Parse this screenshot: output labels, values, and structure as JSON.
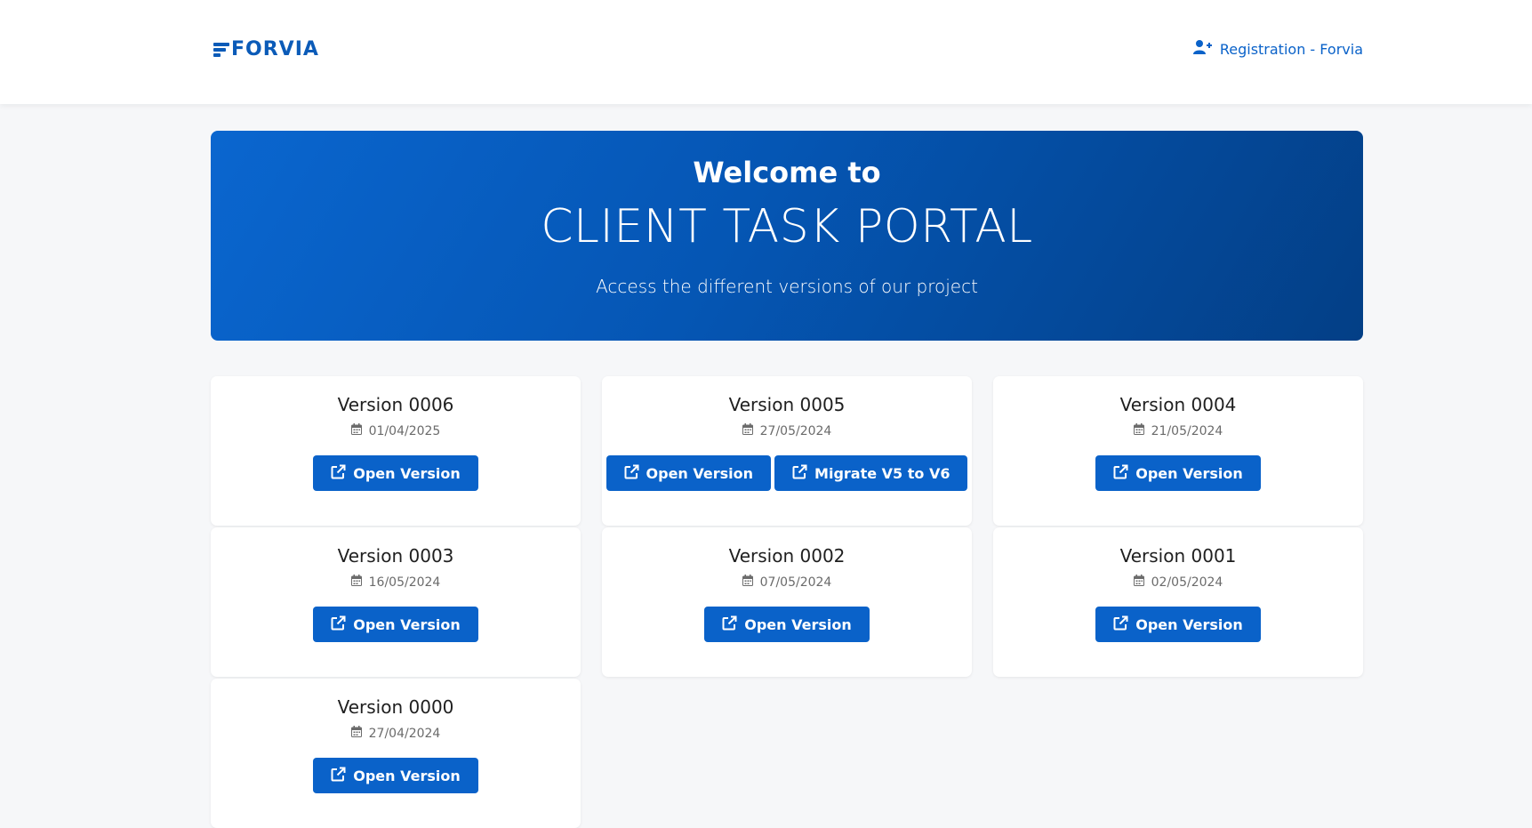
{
  "header": {
    "logo_text": "FORVIA",
    "registration_label": "Registration - Forvia"
  },
  "hero": {
    "welcome": "Welcome to",
    "title": "CLIENT TASK PORTAL",
    "subtitle": "Access the different versions of our project"
  },
  "versions": [
    {
      "name": "Version 0006",
      "date": "01/04/2025",
      "buttons": [
        "Open Version"
      ]
    },
    {
      "name": "Version 0005",
      "date": "27/05/2024",
      "buttons": [
        "Open Version",
        "Migrate V5 to V6"
      ]
    },
    {
      "name": "Version 0004",
      "date": "21/05/2024",
      "buttons": [
        "Open Version"
      ]
    },
    {
      "name": "Version 0003",
      "date": "16/05/2024",
      "buttons": [
        "Open Version"
      ]
    },
    {
      "name": "Version 0002",
      "date": "07/05/2024",
      "buttons": [
        "Open Version"
      ]
    },
    {
      "name": "Version 0001",
      "date": "02/05/2024",
      "buttons": [
        "Open Version"
      ]
    },
    {
      "name": "Version 0000",
      "date": "27/04/2024",
      "buttons": [
        "Open Version"
      ]
    }
  ],
  "icons": {
    "registration": "user-plus-icon",
    "date": "calendar-icon",
    "button": "external-link-icon"
  },
  "colors": {
    "primary": "#0a62c9",
    "hero_start": "#0a66cf",
    "hero_end": "#033f86",
    "background": "#f6f7f9"
  }
}
